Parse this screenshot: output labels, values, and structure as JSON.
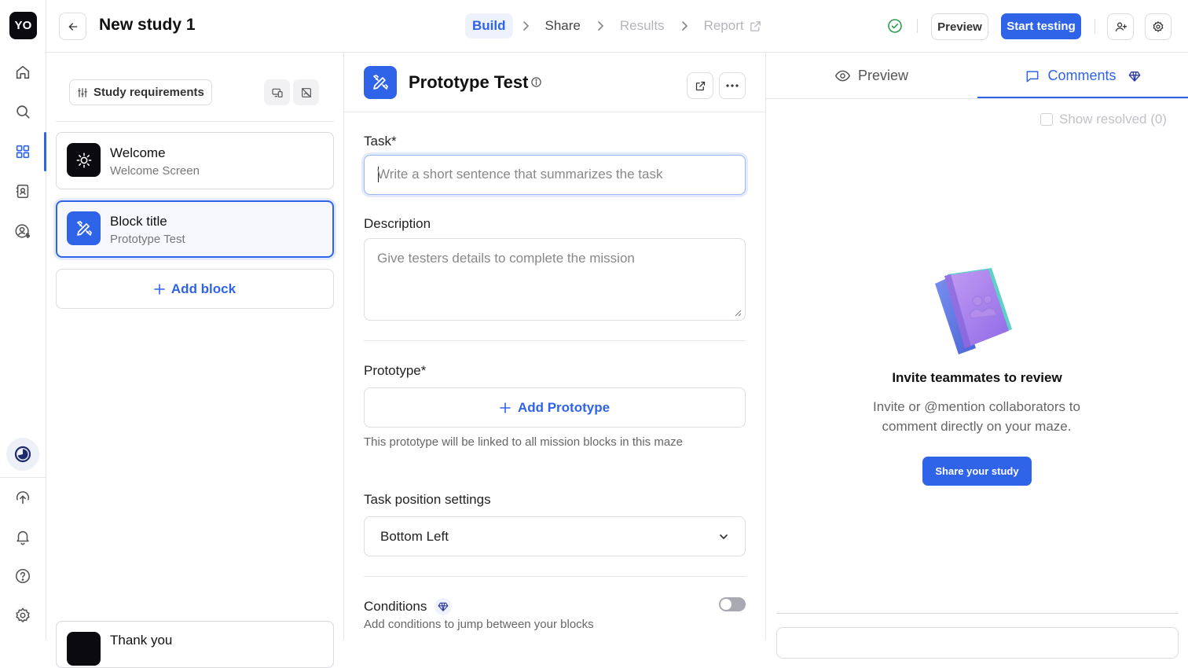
{
  "app": {
    "logo_text": "YO",
    "accent_color": "#2f64e8"
  },
  "rail": {
    "items": [
      {
        "icon": "home-icon"
      },
      {
        "icon": "search-icon"
      },
      {
        "icon": "grid-icon"
      },
      {
        "icon": "contacts-book-icon"
      },
      {
        "icon": "user-dollar-icon"
      }
    ],
    "bottom_items": [
      {
        "icon": "timer-icon"
      },
      {
        "icon": "upload-circle-icon"
      },
      {
        "icon": "bell-icon"
      },
      {
        "icon": "help-icon"
      },
      {
        "icon": "settings-icon"
      }
    ]
  },
  "header": {
    "study_title": "New study 1",
    "steps": [
      {
        "label": "Build",
        "state": "active"
      },
      {
        "label": "Share",
        "state": "default"
      },
      {
        "label": "Results",
        "state": "disabled"
      },
      {
        "label": "Report",
        "state": "disabled"
      }
    ],
    "preview_label": "Preview",
    "start_label": "Start testing"
  },
  "blocks_panel": {
    "requirements_label": "Study requirements",
    "blocks": [
      {
        "title": "Welcome",
        "subtitle": "Welcome Screen"
      },
      {
        "title": "Block title",
        "subtitle": "Prototype Test"
      }
    ],
    "add_block_label": "Add block",
    "thankyou_title": "Thank you"
  },
  "editor": {
    "title": "Prototype Test",
    "task_label": "Task*",
    "task_placeholder": "Write a short sentence that summarizes the task",
    "task_value": "",
    "description_label": "Description",
    "description_placeholder": "Give testers details to complete the mission",
    "prototype_label": "Prototype*",
    "add_prototype_label": "Add Prototype",
    "prototype_help": "This prototype will be linked to all mission blocks in this maze",
    "position_label": "Task position settings",
    "position_value": "Bottom Left",
    "conditions_label": "Conditions",
    "conditions_help": "Add conditions to jump between your blocks",
    "conditions_enabled": false
  },
  "right_panel": {
    "tabs": [
      {
        "label": "Preview",
        "icon": "eye-icon"
      },
      {
        "label": "Comments",
        "icon": "comment-icon"
      }
    ],
    "active_tab": "Comments",
    "show_resolved_label": "Show resolved (0)",
    "empty_title": "Invite teammates to review",
    "empty_desc": "Invite or @mention collaborators to comment directly on your maze.",
    "share_label": "Share your study"
  }
}
